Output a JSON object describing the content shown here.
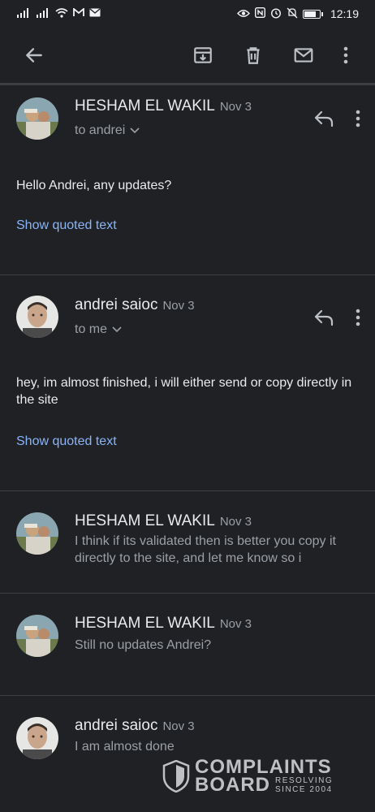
{
  "status_bar": {
    "time": "12:19",
    "battery_level": 0.85,
    "left_icons": [
      "signal-icon",
      "signal-icon",
      "wifi-icon",
      "gmail-icon",
      "mail-icon"
    ],
    "right_icons": [
      "eye-icon",
      "nfc-icon",
      "alarm-icon",
      "mute-icon",
      "battery-icon"
    ]
  },
  "toolbar": {
    "icons": [
      "back-arrow-icon",
      "archive-icon",
      "delete-icon",
      "mark-unread-icon",
      "more-vert-icon"
    ]
  },
  "messages": [
    {
      "sender": "HESHAM EL WAKIL",
      "date": "Nov 3",
      "recipient": "to andrei",
      "body": "Hello Andrei, any updates?",
      "quoted_link": "Show quoted text"
    },
    {
      "sender": "andrei saioc",
      "date": "Nov 3",
      "recipient": "to me",
      "body": "hey, im almost finished, i will either send or copy directly in the site",
      "quoted_link": "Show quoted text"
    },
    {
      "sender": "HESHAM EL WAKIL",
      "date": "Nov 3",
      "snippet": "I think if its validated then is better you copy it directly to the site, and let me know so i"
    },
    {
      "sender": "HESHAM EL WAKIL",
      "date": "Nov 3",
      "snippet": "Still no updates Andrei?"
    },
    {
      "sender": "andrei saioc",
      "date": "Nov 3",
      "snippet": "I am almost done"
    }
  ],
  "watermark": {
    "line1": "COMPLAINTS",
    "line2": "BOARD",
    "tag1": "RESOLVING",
    "tag2": "SINCE 2004"
  },
  "colors": {
    "background": "#202124",
    "link": "#8ab4f8",
    "muted": "#9aa0a6"
  }
}
